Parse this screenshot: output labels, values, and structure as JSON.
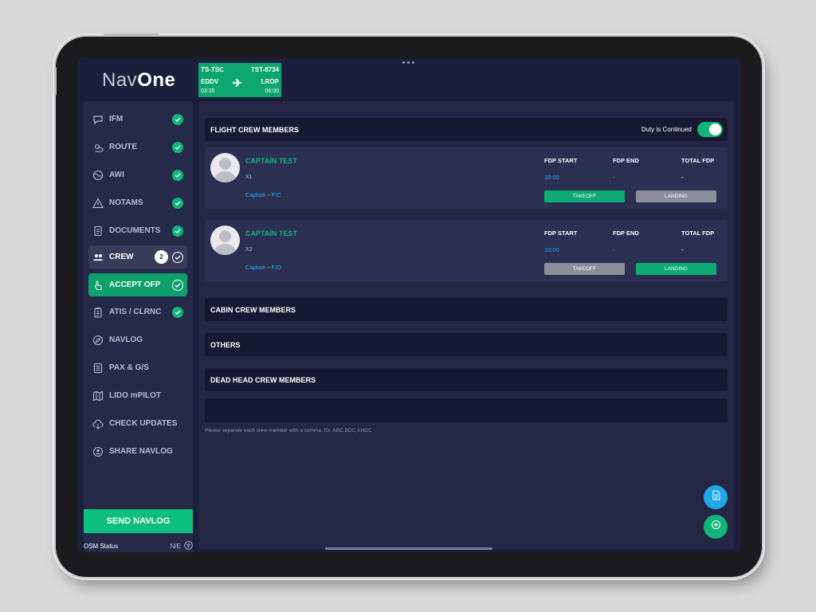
{
  "app": {
    "logo_nav": "Nav",
    "logo_one": "One"
  },
  "flight_tag": {
    "registration": "TS-TSC",
    "flight": "TST-8734",
    "origin": "EDDV",
    "destination": "LROP",
    "dep_time": "03:35",
    "arr_time": "06:00",
    "icon": "airplane-icon"
  },
  "sidebar": {
    "items": [
      {
        "label": "IFM",
        "icon": "chat-bubble-icon",
        "checked": true
      },
      {
        "label": "ROUTE",
        "icon": "weather-icon",
        "checked": true
      },
      {
        "label": "AWI",
        "icon": "globe-icon",
        "checked": true
      },
      {
        "label": "NOTAMS",
        "icon": "warning-icon",
        "checked": true
      },
      {
        "label": "DOCUMENTS",
        "icon": "documents-icon",
        "checked": true
      },
      {
        "label": "CREW",
        "icon": "crew-icon",
        "checked": true,
        "badge": "2",
        "active": true
      },
      {
        "label": "ACCEPT OFP",
        "icon": "hand-tap-icon",
        "checked": true,
        "highlight": true
      },
      {
        "label": "ATIS / CLRNC",
        "icon": "clipboard-icon",
        "checked": true
      },
      {
        "label": "NAVLOG",
        "icon": "compass-icon",
        "checked": false
      },
      {
        "label": "PAX & G/S",
        "icon": "list-icon",
        "checked": false
      },
      {
        "label": "LIDO mPILOT",
        "icon": "map-icon",
        "checked": false
      },
      {
        "label": "CHECK UPDATES",
        "icon": "cloud-download-icon",
        "checked": false
      },
      {
        "label": "SHARE NAVLOG",
        "icon": "share-icon",
        "checked": false
      }
    ],
    "send_label": "SEND NAVLOG",
    "osm_label": "OSM Status",
    "osm_value": "N/E"
  },
  "flight_crew": {
    "title": "FLIGHT CREW MEMBERS",
    "duty_label": "Duty is Continued",
    "duty_on": true,
    "headers": {
      "fdp_start": "FDP START",
      "fdp_end": "FDP END",
      "total_fdp": "TOTAL FDP"
    },
    "members": [
      {
        "name": "CAPTAİN TEST",
        "position": "X1",
        "role": "Captain",
        "duty": "PIC",
        "fdp_start": "10:00",
        "fdp_end": "-",
        "total_fdp": "-",
        "takeoff_label": "TAKEOFF",
        "landing_label": "LANDING",
        "selected": "takeoff"
      },
      {
        "name": "CAPTAİN TEST",
        "position": "X2",
        "role": "Captain",
        "duty": "F/O",
        "fdp_start": "10:00",
        "fdp_end": "-",
        "total_fdp": "-",
        "takeoff_label": "TAKEOFF",
        "landing_label": "LANDING",
        "selected": "landing"
      }
    ]
  },
  "sections": {
    "cabin": "CABIN CREW MEMBERS",
    "others": "OTHERS",
    "deadhead": "DEAD HEAD CREW MEMBERS",
    "deadhead_value": "",
    "hint": "Please separate each crew member with a comma. Ex: ABC,BDC,XHGC"
  },
  "colors": {
    "accent_green": "#12b47a",
    "link_blue": "#29a6ff",
    "background": "#1c1f3b"
  }
}
